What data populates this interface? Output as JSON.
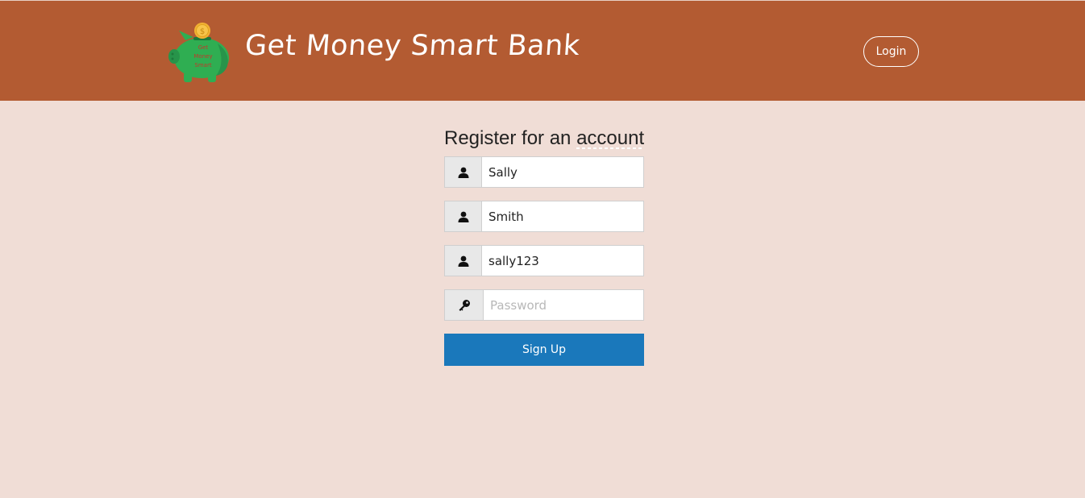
{
  "header": {
    "brand": "Get Money Smart Bank",
    "logo_text": [
      "Get",
      "Money",
      "Smart"
    ],
    "logo_coin": "$",
    "login_label": "Login",
    "background_color": "#b35b32"
  },
  "form": {
    "title": "Register for an account",
    "fields": [
      {
        "icon": "user-icon",
        "value": "Sally",
        "placeholder": ""
      },
      {
        "icon": "user-icon",
        "value": "Smith",
        "placeholder": ""
      },
      {
        "icon": "user-icon",
        "value": "sally123",
        "placeholder": ""
      },
      {
        "icon": "key-icon",
        "value": "",
        "placeholder": "Password"
      }
    ],
    "submit_label": "Sign Up",
    "submit_color": "#1a78bb"
  },
  "page": {
    "background_color": "#f0ddd6"
  }
}
